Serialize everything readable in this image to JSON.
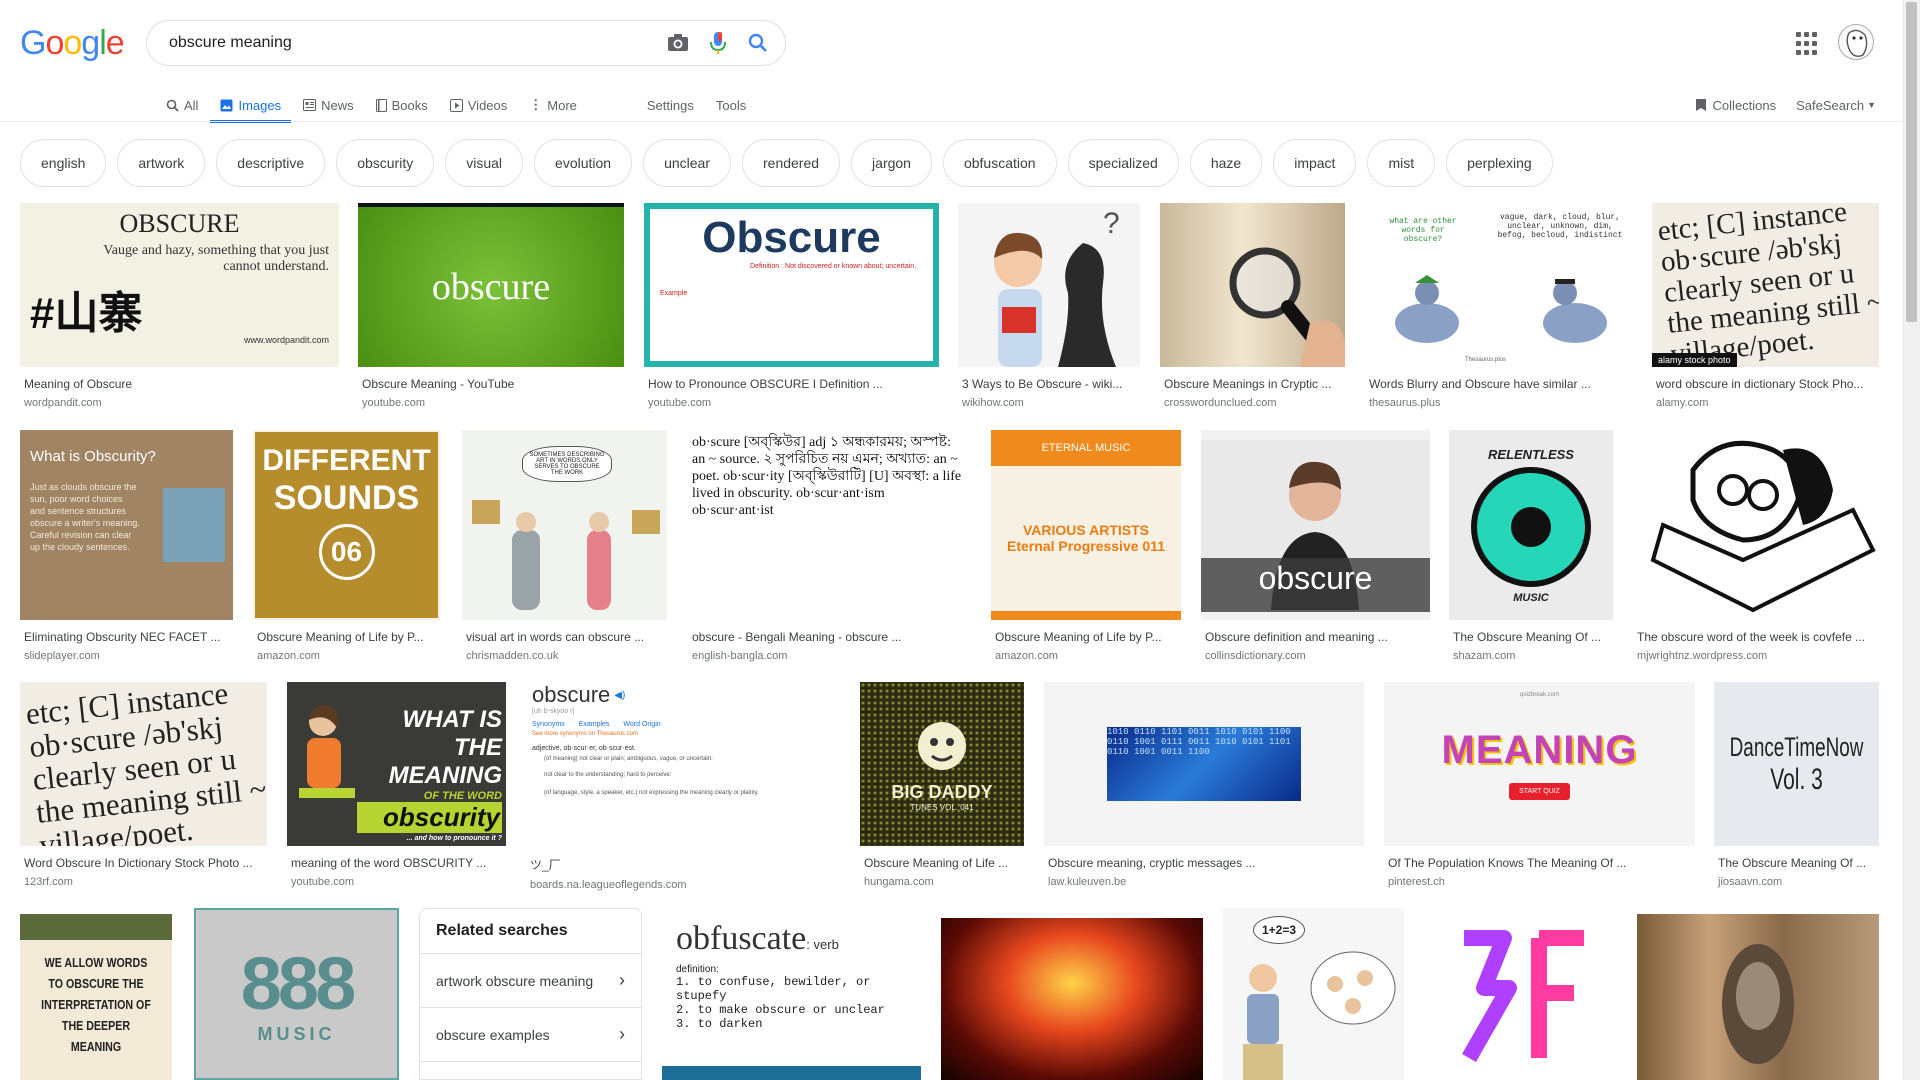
{
  "logo": {
    "letters": [
      "G",
      "o",
      "o",
      "g",
      "l",
      "e"
    ],
    "colors": [
      "#4285f4",
      "#ea4335",
      "#fbbc05",
      "#4285f4",
      "#34a853",
      "#ea4335"
    ]
  },
  "search": {
    "query": "obscure meaning"
  },
  "tabs": [
    {
      "label": "All",
      "icon": "search-icon"
    },
    {
      "label": "Images",
      "icon": "image-icon",
      "active": true
    },
    {
      "label": "News",
      "icon": "news-icon"
    },
    {
      "label": "Books",
      "icon": "book-icon"
    },
    {
      "label": "Videos",
      "icon": "video-icon"
    },
    {
      "label": "More",
      "icon": "more-vert-icon"
    }
  ],
  "tools": {
    "settings": "Settings",
    "tools": "Tools"
  },
  "right": {
    "collections": "Collections",
    "safesearch": "SafeSearch"
  },
  "chips": [
    "english",
    "artwork",
    "descriptive",
    "obscurity",
    "visual",
    "evolution",
    "unclear",
    "rendered",
    "jargon",
    "obfuscation",
    "specialized",
    "haze",
    "impact",
    "mist",
    "perplexing"
  ],
  "row1": [
    {
      "caption": "Meaning of Obscure",
      "source": "wordpandit.com",
      "thumb": {
        "title": "OBSCURE",
        "sub": "Vauge and hazy, something that you just cannot understand.",
        "big": "#山寨",
        "foot": "www.wordpandit.com"
      }
    },
    {
      "caption": "Obscure Meaning - YouTube",
      "source": "youtube.com",
      "thumb": {
        "word": "obscure"
      }
    },
    {
      "caption": "How to Pronounce OBSCURE I Definition ...",
      "source": "youtube.com",
      "thumb": {
        "word": "Obscure",
        "def": "Definition : Not discovered or known about; uncertain.",
        "label": "Example"
      }
    },
    {
      "caption": "3 Ways to Be Obscure - wiki...",
      "source": "wikihow.com"
    },
    {
      "caption": "Obscure Meanings in Cryptic ...",
      "source": "crosswordunclued.com"
    },
    {
      "caption": "Words Blurry and Obscure have similar ...",
      "source": "thesaurus.plus",
      "thumb": {
        "q": "what are other words for obscure?",
        "words": "vague, dark, cloud, blur, unclear, unknown, dim, befog, becloud, indistinct",
        "foot": "Thesaurus.plus"
      }
    },
    {
      "caption": "word obscure in dictionary Stock Pho...",
      "source": "alamy.com",
      "thumb": {
        "text": "etc; [C] instance ob·scure /əb'skj clearly seen or u the meaning still ~ village/poet.",
        "badge": "alamy stock photo"
      }
    }
  ],
  "row2": [
    {
      "caption": "Eliminating Obscurity NEC FACET ...",
      "source": "slideplayer.com",
      "thumb": {
        "title": "What is Obscurity?",
        "body": "Just as clouds obscure the sun, poor word choices and sentence structures obscure a writer's meaning. Careful revision can clear up the cloudy sentences."
      }
    },
    {
      "caption": "Obscure Meaning of Life by P...",
      "source": "amazon.com",
      "thumb": {
        "line1": "DIFFERENT",
        "line2": "SOUNDS",
        "num": "06"
      }
    },
    {
      "caption": "visual art in words can obscure ...",
      "source": "chrismadden.co.uk",
      "thumb": {
        "bubble": "SOMETIMES DESCRIBING ART IN WORDS ONLY SERVES TO OBSCURE THE WORK"
      }
    },
    {
      "caption": "obscure - Bengali Meaning - obscure ...",
      "source": "english-bangla.com",
      "thumb": {
        "text": "ob·scure [অব্‌স্কিউর] adj ১ অন্ধকারময়; অস্পষ্ট: an ~ source. ২ সুপরিচিত নয় এমন; অখ্যাত: an ~ poet. ob·scur·ity [অব্‌স্কিউরাটি] [U] অবস্থা: a life lived in obscurity. ob·scur·ant·ism ob·scur·ant·ist"
      }
    },
    {
      "caption": "Obscure Meaning of Life by P...",
      "source": "amazon.com",
      "thumb": {
        "brand": "ETERNAL MUSIC",
        "l1": "VARIOUS ARTISTS",
        "l2": "Eternal Progressive 011"
      }
    },
    {
      "caption": "Obscure definition and meaning ...",
      "source": "collinsdictionary.com",
      "thumb": {
        "word": "obscure"
      }
    },
    {
      "caption": "The Obscure Meaning Of ...",
      "source": "shazam.com",
      "thumb": {
        "top": "RELENTLESS",
        "bottom": "MUSIC"
      }
    },
    {
      "caption": "The obscure word of the week is covfefe ...",
      "source": "mjwrightnz.wordpress.com"
    }
  ],
  "row3": [
    {
      "caption": "Word Obscure In Dictionary Stock Photo ...",
      "source": "123rf.com",
      "thumb": {
        "text": "etc; [C] instance ob·scure /əb'skj clearly seen or u the meaning still ~ village/poet."
      }
    },
    {
      "caption": "meaning of the word OBSCURITY ...",
      "source": "youtube.com",
      "thumb": {
        "l1": "WHAT IS",
        "l2": "THE MEANING",
        "l3": "OF THE WORD",
        "l4": "obscurity",
        "l5": "... and how to pronounce it ?"
      }
    },
    {
      "caption": "ツ_厂",
      "source": "boards.na.leagueoflegends.com",
      "thumb": {
        "word": "obscure",
        "pron": "[uh b-skyoo r]",
        "links": [
          "Synonyms",
          "Examples",
          "Word Origin"
        ],
        "more": "See more synonyms on Thesaurus.com",
        "pos": "adjective, ob·scur·er, ob·scur·est.",
        "d1": "(of meaning) not clear or plain; ambiguous, vague, or uncertain:",
        "d2": "not clear to the understanding; hard to perceive:",
        "d3": "(of language, style, a speaker, etc.) not expressing the meaning clearly or plainly."
      }
    },
    {
      "caption": "Obscure Meaning of Life ...",
      "source": "hungama.com",
      "thumb": {
        "l1": "BIG DADDY",
        "l2": "TUNES VOL. 041"
      }
    },
    {
      "caption": "Obscure meaning, cryptic messages ...",
      "source": "law.kuleuven.be"
    },
    {
      "caption": "Of The Population Knows The Meaning Of ...",
      "source": "pinterest.ch",
      "thumb": {
        "word": "MEANING",
        "btn": "START QUIZ",
        "top": "quizbreak.com"
      }
    },
    {
      "caption": "The Obscure Meaning Of ...",
      "source": "jiosaavn.com",
      "thumb": {
        "l1": "DanceTimeNow",
        "l2": "Vol. 3"
      }
    }
  ],
  "row4": {
    "quote": "WE ALLOW WORDS TO OBSCURE THE INTERPRETATION OF THE DEEPER MEANING",
    "music": {
      "num": "888",
      "label": "MUSIC"
    },
    "related": {
      "title": "Related searches",
      "items": [
        "artwork obscure meaning",
        "obscure examples"
      ]
    },
    "obf": {
      "word": "obfuscate",
      "pos": ": verb",
      "defhead": "definition:",
      "d1": "1. to confuse, bewilder, or stupefy",
      "d2": "2. to make obscure or unclear",
      "d3": "3. to darken"
    },
    "math": "1+2=3"
  }
}
